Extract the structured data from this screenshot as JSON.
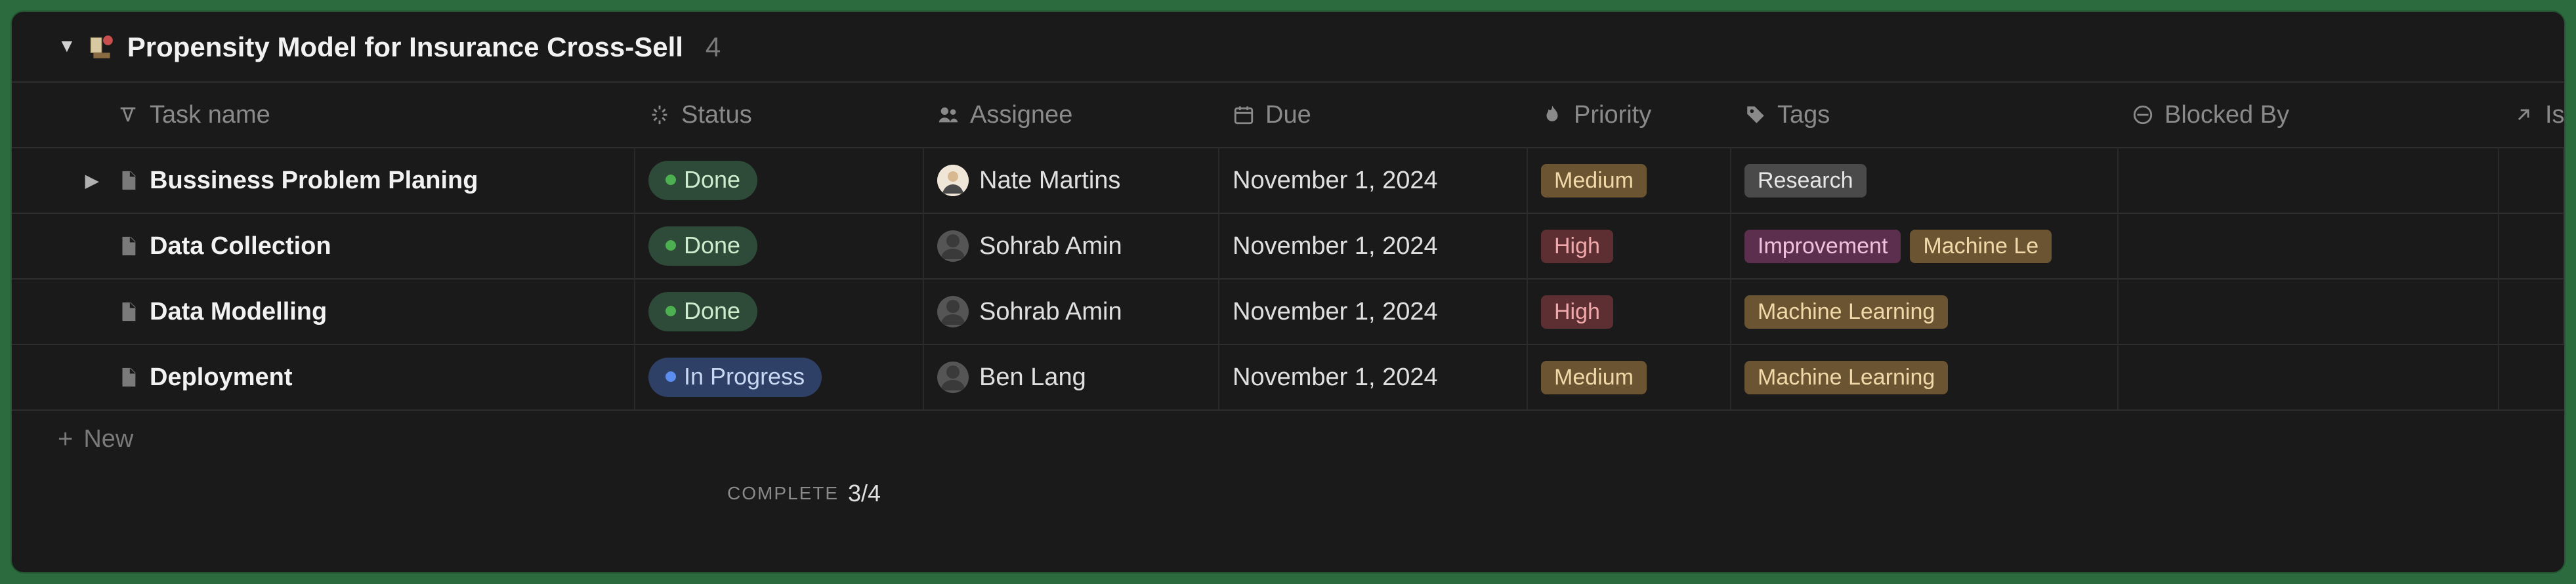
{
  "group": {
    "title": "Propensity Model for Insurance Cross-Sell",
    "count": "4"
  },
  "columns": {
    "task": "Task name",
    "status": "Status",
    "assignee": "Assignee",
    "due": "Due",
    "priority": "Priority",
    "tags": "Tags",
    "blocked": "Blocked By",
    "is": "Is"
  },
  "rows": [
    {
      "expandable": true,
      "name": "Bussiness Problem Planing",
      "status": {
        "label": "Done",
        "kind": "done"
      },
      "assignee": {
        "name": "Nate Martins",
        "photo": true
      },
      "due": "November 1, 2024",
      "priority": {
        "label": "Medium",
        "kind": "medium"
      },
      "tags": [
        {
          "label": "Research",
          "kind": "research"
        }
      ]
    },
    {
      "expandable": false,
      "name": "Data Collection",
      "status": {
        "label": "Done",
        "kind": "done"
      },
      "assignee": {
        "name": "Sohrab Amin",
        "photo": false
      },
      "due": "November 1, 2024",
      "priority": {
        "label": "High",
        "kind": "high"
      },
      "tags": [
        {
          "label": "Improvement",
          "kind": "improve"
        },
        {
          "label": "Machine Le",
          "kind": "ml"
        }
      ]
    },
    {
      "expandable": false,
      "name": "Data Modelling",
      "status": {
        "label": "Done",
        "kind": "done"
      },
      "assignee": {
        "name": "Sohrab Amin",
        "photo": false
      },
      "due": "November 1, 2024",
      "priority": {
        "label": "High",
        "kind": "high"
      },
      "tags": [
        {
          "label": "Machine Learning",
          "kind": "ml"
        }
      ]
    },
    {
      "expandable": false,
      "name": "Deployment",
      "status": {
        "label": "In Progress",
        "kind": "progress"
      },
      "assignee": {
        "name": "Ben Lang",
        "photo": false
      },
      "due": "November 1, 2024",
      "priority": {
        "label": "Medium",
        "kind": "medium"
      },
      "tags": [
        {
          "label": "Machine Learning",
          "kind": "ml"
        }
      ]
    }
  ],
  "newRow": "New",
  "footer": {
    "label": "Complete",
    "fraction": "3/4"
  }
}
